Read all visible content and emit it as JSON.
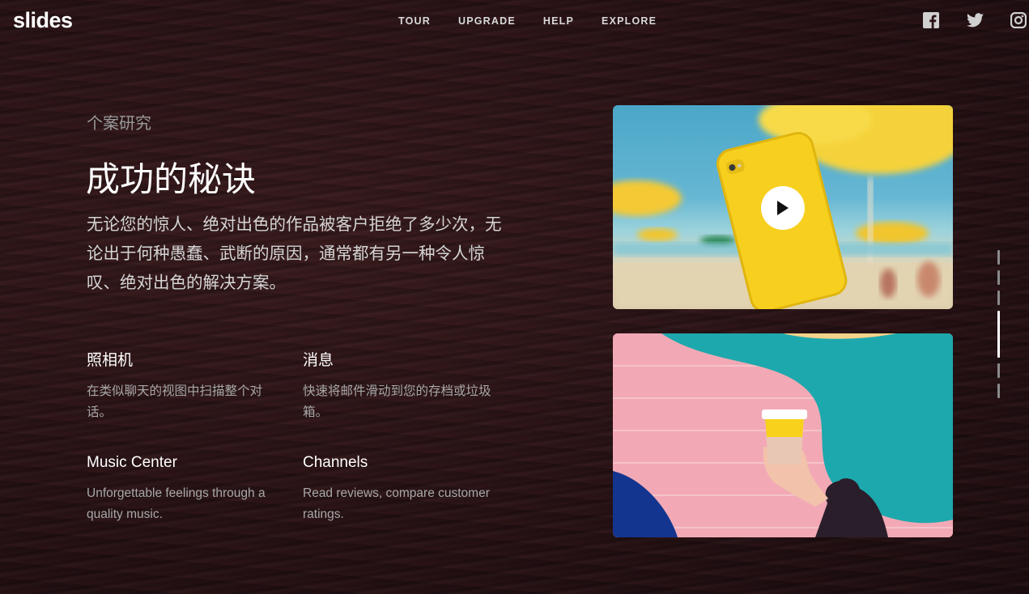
{
  "header": {
    "logo": "slides",
    "nav": [
      "TOUR",
      "UPGRADE",
      "HELP",
      "EXPLORE"
    ],
    "social": [
      "facebook-icon",
      "twitter-icon",
      "instagram-icon"
    ]
  },
  "hero": {
    "eyebrow": "个案研究",
    "title": "成功的秘诀",
    "lead": "无论您的惊人、绝对出色的作品被客户拒绝了多少次，无论出于何种愚蠢、武断的原因，通常都有另一种令人惊叹、绝对出色的解决方案。"
  },
  "features": [
    {
      "title": "照相机",
      "desc": "在类似聊天的视图中扫描整个对话。"
    },
    {
      "title": "消息",
      "desc": "快速将邮件滑动到您的存档或垃圾箱。"
    },
    {
      "title": "Music Center",
      "desc": "Unforgettable feelings through a quality music."
    },
    {
      "title": "Channels",
      "desc": "Read reviews, compare customer ratings."
    }
  ],
  "media": {
    "video_play": "play-icon",
    "image2": "coffee-cup-on-mural"
  },
  "pager": {
    "count": 6,
    "active": 3
  },
  "colors": {
    "accent": "#ffffff",
    "muted_text": "#a8a8a8",
    "phone_yellow": "#f7cf1f"
  }
}
